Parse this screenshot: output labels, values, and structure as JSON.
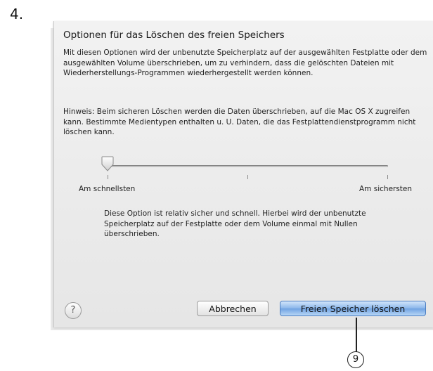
{
  "step_number": "4.",
  "dialog": {
    "title": "Optionen für das Löschen des freien Speichers",
    "intro_text": "Mit diesen Optionen wird der unbenutzte Speicherplatz auf der ausgewählten Festplatte oder dem ausgewählten Volume überschrieben, um zu verhindern, dass die gelöschten Dateien mit Wiederherstellungs-Programmen wiederhergestellt werden können.",
    "note_text": "Hinweis: Beim sicheren Löschen werden die Daten überschrieben, auf die Mac OS X zugreifen kann. Bestimmte Medientypen enthalten u. U. Daten, die das Festplattendienstprogramm nicht löschen kann.",
    "slider": {
      "min_label": "Am schnellsten",
      "max_label": "Am sichersten",
      "value": 0,
      "steps": 3
    },
    "description": "Diese Option ist relativ sicher und schnell. Hierbei wird der unbenutzte Speicherplatz auf der Festplatte oder dem Volume einmal mit Nullen überschrieben.",
    "help_label": "?",
    "cancel_label": "Abbrechen",
    "confirm_label": "Freien Speicher löschen"
  },
  "callout_label": "9",
  "colors": {
    "primary_button": "#8ab6ea",
    "sheet_background": "#eeeeee"
  }
}
